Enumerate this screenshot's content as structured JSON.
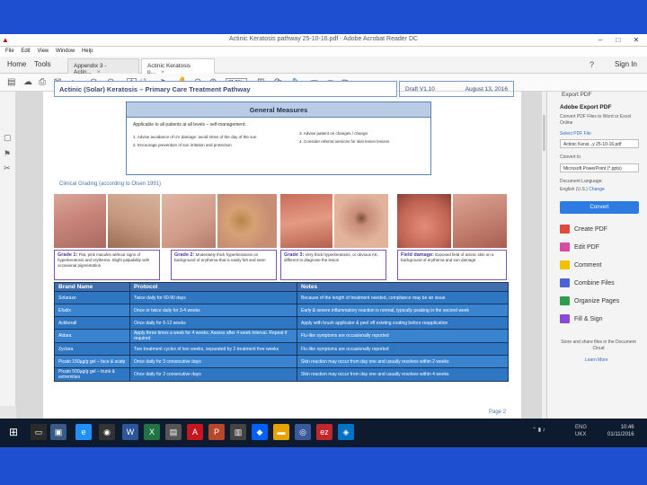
{
  "window": {
    "title": "Actinic Keratosis pathway 25-10-16.pdf - Adobe Acrobat Reader DC",
    "controls": [
      "–",
      "□",
      "✕"
    ]
  },
  "menu": [
    "File",
    "Edit",
    "View",
    "Window",
    "Help"
  ],
  "tabs": {
    "home": "Home",
    "tools": "Tools",
    "docs": [
      {
        "label": "Appendix 3 - Actin...",
        "close": "×"
      },
      {
        "label": "Actinic Keratosis p...",
        "close": "×"
      }
    ],
    "help": "?",
    "signin": "Sign In"
  },
  "toolbar": {
    "page_current": "1",
    "page_total": "/ 2",
    "zoom": "61.9%"
  },
  "document": {
    "title": "Actinic (Solar) Keratosis – Primary Care Treatment Pathway",
    "draft": "Draft V1.10",
    "date": "August 13, 2016",
    "general_measures": {
      "heading": "General Measures",
      "intro": "Applicable to all patients at all levels – self-management:",
      "items": [
        "1. Advise avoidance of UV damage: avoid times of the day of the sun",
        "2. Encourage prevention of sun irritation and protection",
        "3. Advise patient on changes / change",
        "4. Consider referral services for skin lesion lesions"
      ]
    },
    "clinical_grading": "Clinical Grading (according to Olsen 1991)",
    "grades": [
      {
        "label": "Grade 1:",
        "text": "Flat, pink macules without signs of hyperkeratosis and erythema. Slight palpability with occasional pigmentation"
      },
      {
        "label": "Grade 2:",
        "text": "Moderately thick hyperkeratosis on background of erythema that is easily felt and seen"
      },
      {
        "label": "Grade 3:",
        "text": "Very thick hyperkeratosis, or obvious AK, different to diagnose the lesion"
      },
      {
        "label": "Field damage:",
        "text": "Exposed field of actinic skin on a background of erythema and sun damage"
      }
    ],
    "table": {
      "headers": [
        "Brand Name",
        "Protocol",
        "Notes"
      ],
      "rows": [
        [
          "Solaraze",
          "Twice daily for 60-90 days",
          "Because of the length of treatment needed, compliance may be an issue"
        ],
        [
          "Efudix",
          "Once or twice daily for 3-4 weeks",
          "Early & severe inflammatory reaction is normal, typically peaking in the second week"
        ],
        [
          "Actikerall",
          "Once daily for 6-12 weeks",
          "Apply with brush applicator & peel off existing coating before reapplication"
        ],
        [
          "Aldara",
          "Apply three times a week for 4 weeks. Assess after 4 week interval. Repeat if required",
          "Flu-like symptoms are occasionally reported"
        ],
        [
          "Zyclara",
          "Two treatment cycles of two weeks, separated by 2 treatment free weeks",
          "Flu-like symptoms are occasionally reported"
        ],
        [
          "Picato 150µg/g gel – face & scalp",
          "Once daily for 3 consecutive days",
          "Skin reaction may occur from day one and usually resolves within 2 weeks"
        ],
        [
          "Picato 500µg/g gel – trunk & extremities",
          "Once daily for 2 consecutive days",
          "Skin reaction may occur from day one and usually resolves within 4 weeks"
        ]
      ]
    },
    "page_label": "Page 2"
  },
  "right_panel": {
    "top_item": "Export PDF",
    "heading": "Adobe Export PDF",
    "description": "Convert PDF Files to Word or Excel Online",
    "select_link": "Select PDF File",
    "file_name": "Actinic Kerat...y 25-10-16.pdf",
    "convert_to_label": "Convert to",
    "format": "Microsoft PowerPoint (*.pptx)",
    "doc_lang_label": "Document Language:",
    "doc_lang": "English (U.S.)",
    "change": "Change",
    "convert_button": "Convert",
    "tools": [
      "Create PDF",
      "Edit PDF",
      "Comment",
      "Combine Files",
      "Organize Pages",
      "Fill & Sign"
    ],
    "store_text": "Store and share files in the Document Cloud",
    "learn_more": "Learn More"
  },
  "taskbar": {
    "tray": [
      "ENG",
      "UKX"
    ],
    "time": "10:46",
    "date": "01/11/2016"
  },
  "colors": {
    "table_body": "#2f77c3",
    "table_head": "#3f6fb0",
    "grade_border": "#7b55b3",
    "convert": "#2d7be0"
  }
}
